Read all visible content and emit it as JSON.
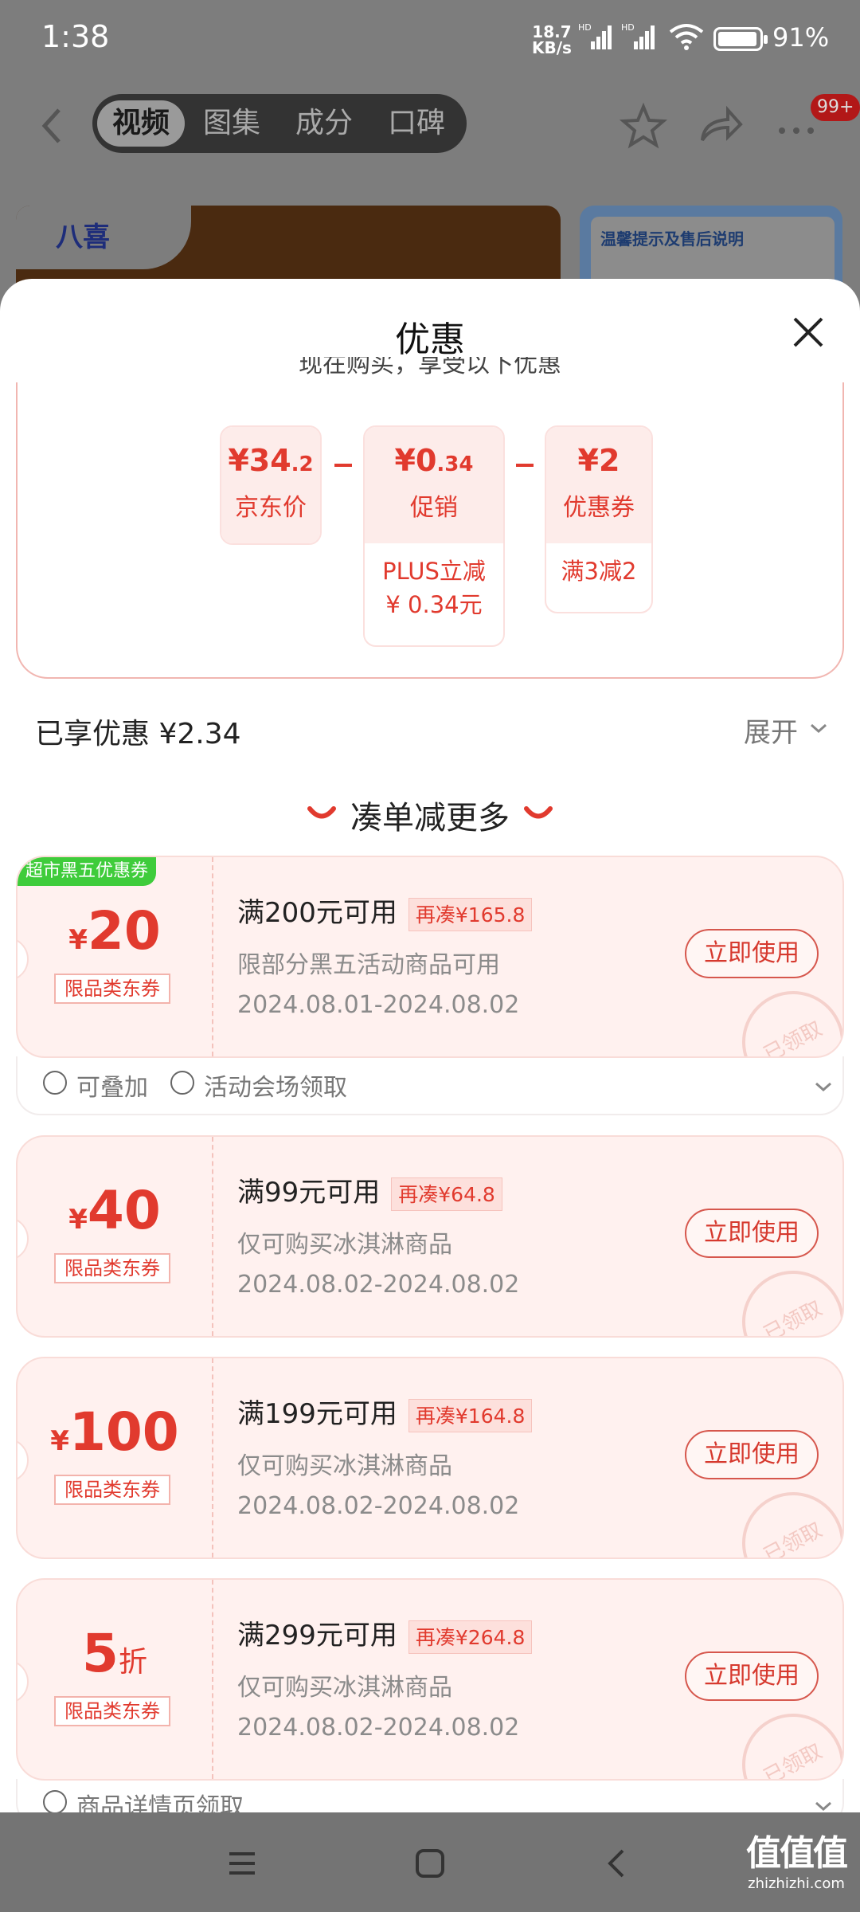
{
  "status": {
    "time": "1:38",
    "speed_top": "18.7",
    "speed_bottom": "KB/s",
    "net1": "HD",
    "net2": "HD",
    "battery": "91%"
  },
  "header": {
    "tabs": [
      {
        "label": "视频",
        "active": true
      },
      {
        "label": "图集"
      },
      {
        "label": "成分"
      },
      {
        "label": "口碑"
      }
    ],
    "badge": "99+",
    "brand_logo": "八喜",
    "side_card_title": "温馨提示及售后说明"
  },
  "sheet": {
    "title": "优惠",
    "tip": "现在购买，享受以下优惠",
    "price_breakdown": [
      {
        "amount_main": "¥34",
        "amount_dec": ".2",
        "label": "京东价",
        "sub": ""
      },
      {
        "amount_main": "¥0",
        "amount_dec": ".34",
        "label": "促销",
        "sub1": "PLUS立减",
        "sub2": "¥ 0.34元"
      },
      {
        "amount_main": "¥2",
        "amount_dec": "",
        "label": "优惠券",
        "sub1": "满3减2"
      }
    ],
    "enjoyed": "已享优惠 ¥2.34",
    "expand": "展开",
    "more_title": "凑单减更多"
  },
  "coupons": [
    {
      "tag": "超市黑五优惠券",
      "currency": "¥",
      "value": "20",
      "unit": "",
      "category": "限品类东券",
      "condition": "满200元可用",
      "need": "再凑¥165.8",
      "desc": "限部分黑五活动商品可用",
      "date": "2024.08.01-2024.08.02",
      "button": "立即使用",
      "stamp": "已领取"
    },
    {
      "currency": "¥",
      "value": "40",
      "unit": "",
      "category": "限品类东券",
      "condition": "满99元可用",
      "need": "再凑¥64.8",
      "desc": "仅可购买冰淇淋商品",
      "date": "2024.08.02-2024.08.02",
      "button": "立即使用",
      "stamp": "已领取"
    },
    {
      "currency": "¥",
      "value": "100",
      "unit": "",
      "category": "限品类东券",
      "condition": "满199元可用",
      "need": "再凑¥164.8",
      "desc": "仅可购买冰淇淋商品",
      "date": "2024.08.02-2024.08.02",
      "button": "立即使用",
      "stamp": "已领取"
    },
    {
      "currency": "",
      "value": "5",
      "unit": "折",
      "category": "限品类东券",
      "condition": "满299元可用",
      "need": "再凑¥264.8",
      "desc": "仅可购买冰淇淋商品",
      "date": "2024.08.02-2024.08.02",
      "button": "立即使用",
      "stamp": "已领取"
    }
  ],
  "coupon_extras": {
    "stackable": "可叠加",
    "venue": "活动会场领取",
    "detail_page": "商品详情页领取"
  },
  "watermark": {
    "big": "值值值",
    "small": "zhizhizhi.com"
  },
  "colors": {
    "accent": "#e13a2e",
    "coupon_bg": "#fff1ef",
    "green_tag": "#3fcc3b"
  }
}
